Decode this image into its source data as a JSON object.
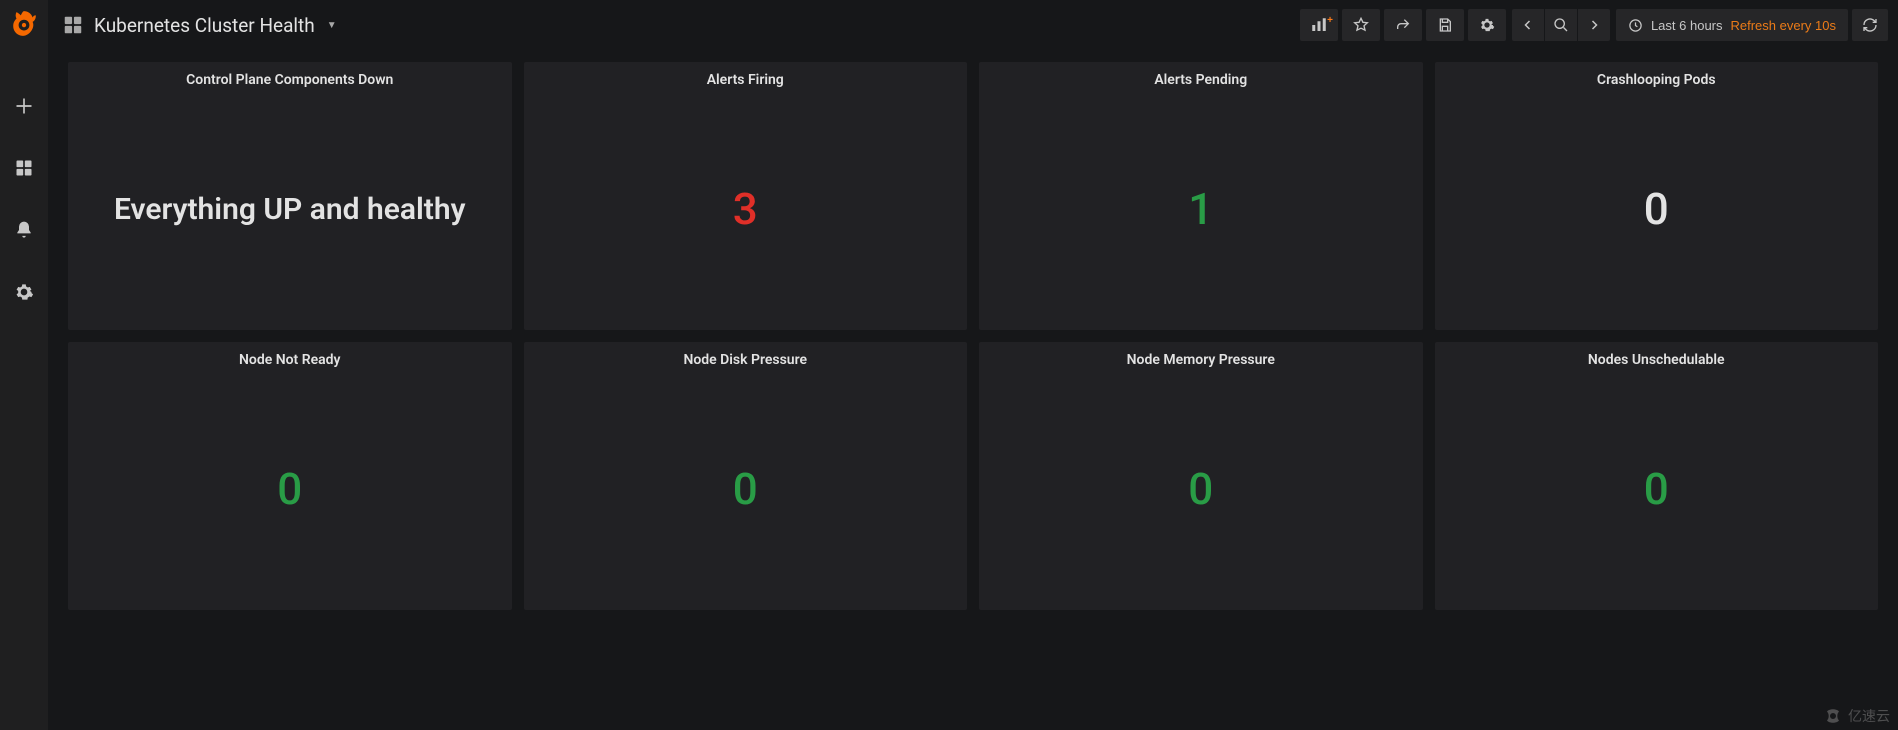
{
  "header": {
    "title": "Kubernetes Cluster Health"
  },
  "toolbar": {
    "time_range_label": "Last 6 hours",
    "refresh_label": "Refresh every 10s"
  },
  "panels": [
    {
      "title": "Control Plane Components Down",
      "value": "Everything UP and healthy",
      "kind": "text",
      "color": "white"
    },
    {
      "title": "Alerts Firing",
      "value": "3",
      "kind": "number",
      "color": "red"
    },
    {
      "title": "Alerts Pending",
      "value": "1",
      "kind": "number",
      "color": "green"
    },
    {
      "title": "Crashlooping Pods",
      "value": "0",
      "kind": "number",
      "color": "white"
    },
    {
      "title": "Node Not Ready",
      "value": "0",
      "kind": "number",
      "color": "green"
    },
    {
      "title": "Node Disk Pressure",
      "value": "0",
      "kind": "number",
      "color": "green"
    },
    {
      "title": "Node Memory Pressure",
      "value": "0",
      "kind": "number",
      "color": "green"
    },
    {
      "title": "Nodes Unschedulable",
      "value": "0",
      "kind": "number",
      "color": "green"
    }
  ],
  "watermark": {
    "text": "亿速云"
  }
}
